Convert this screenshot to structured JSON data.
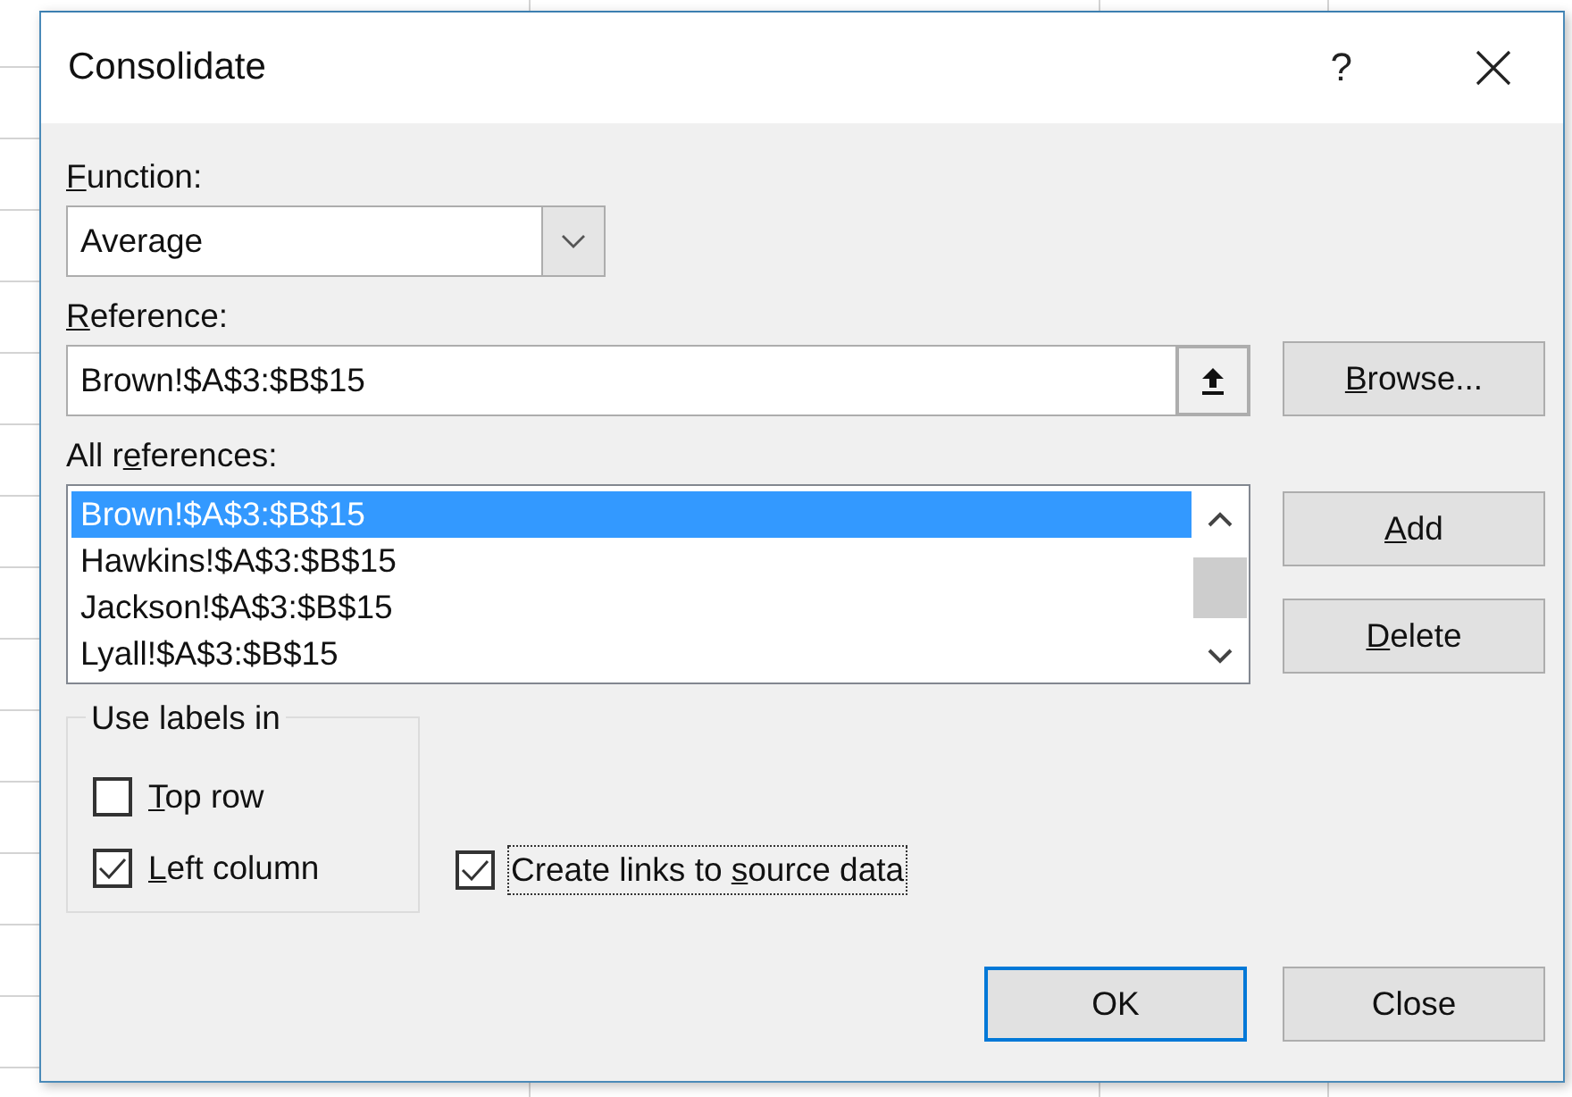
{
  "window": {
    "title": "Consolidate",
    "help": "?"
  },
  "function": {
    "label": {
      "key": "F",
      "post": "unction:"
    },
    "value": "Average"
  },
  "reference": {
    "label": {
      "key": "R",
      "post": "eference:"
    },
    "value": "Brown!$A$3:$B$15"
  },
  "browse_button": {
    "key": "B",
    "post": "rowse..."
  },
  "all_references": {
    "label": {
      "pre": "All r",
      "key": "e",
      "post": "ferences:"
    },
    "items": [
      {
        "text": "Brown!$A$3:$B$15",
        "selected": true
      },
      {
        "text": "Hawkins!$A$3:$B$15",
        "selected": false
      },
      {
        "text": "Jackson!$A$3:$B$15",
        "selected": false
      },
      {
        "text": "Lyall!$A$3:$B$15",
        "selected": false
      }
    ]
  },
  "add_button": {
    "key": "A",
    "post": "dd"
  },
  "delete_button": {
    "key": "D",
    "post": "elete"
  },
  "use_labels": {
    "legend": "Use labels in",
    "options": [
      {
        "label": {
          "key": "T",
          "post": "op row"
        },
        "checked": false
      },
      {
        "label": {
          "key": "L",
          "post": "eft column"
        },
        "checked": true
      }
    ]
  },
  "create_links": {
    "label": {
      "pre": "Create links to ",
      "key": "s",
      "post": "ource data"
    },
    "checked": true,
    "focused": true
  },
  "buttons": [
    {
      "text": "OK",
      "default": true
    },
    {
      "text": "Close",
      "default": false
    }
  ]
}
